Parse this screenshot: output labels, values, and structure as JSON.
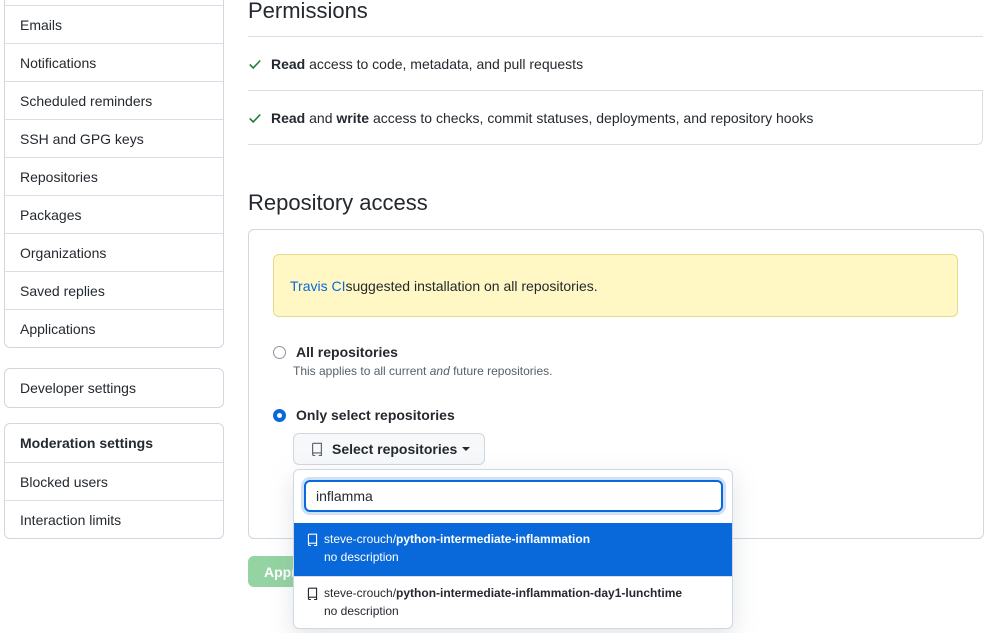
{
  "sidebar": {
    "group1": [
      "Emails",
      "Notifications",
      "Scheduled reminders",
      "SSH and GPG keys",
      "Repositories",
      "Packages",
      "Organizations",
      "Saved replies",
      "Applications"
    ],
    "developer_settings": "Developer settings",
    "moderation": {
      "heading": "Moderation settings",
      "items": [
        "Blocked users",
        "Interaction limits"
      ]
    }
  },
  "permissions": {
    "title": "Permissions",
    "row1": {
      "bold1": "Read",
      "rest": " access to code, metadata, and pull requests"
    },
    "row2": {
      "bold1": "Read",
      "mid": " and ",
      "bold2": "write",
      "rest": " access to checks, commit statuses, deployments, and repository hooks"
    }
  },
  "repository_access": {
    "title": "Repository access",
    "flash": {
      "link": "Travis CI",
      "text": " suggested installation on all repositories."
    },
    "all_repos": {
      "label": "All repositories",
      "note_pre": "This applies to all current ",
      "note_em": "and",
      "note_post": " future repositories."
    },
    "select_repos": {
      "label": "Only select repositories"
    },
    "select_button": "Select repositories",
    "approve_button": "Approve & Install"
  },
  "dropdown": {
    "search_value": "inflamma",
    "results": [
      {
        "owner": "steve-crouch/",
        "repo": "python-intermediate-inflammation",
        "desc": "no description",
        "selected": true
      },
      {
        "owner": "steve-crouch/",
        "repo": "python-intermediate-inflammation-day1-lunchtime",
        "desc": "no description",
        "selected": false
      }
    ]
  },
  "colors": {
    "accent": "#0969da",
    "check": "#1a7f37",
    "flash_bg": "#fff8c5",
    "approve": "#94d3a2"
  }
}
